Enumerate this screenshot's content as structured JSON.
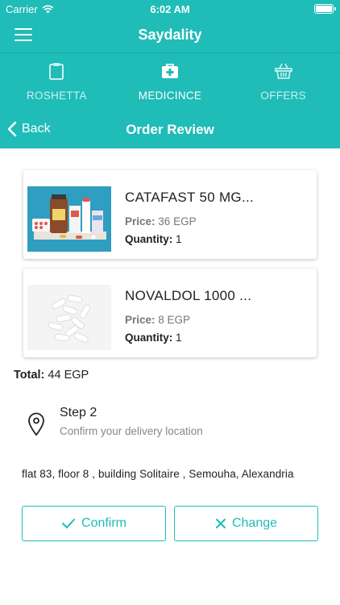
{
  "status_bar": {
    "carrier": "Carrier",
    "time": "6:02 AM"
  },
  "app_bar": {
    "title": "Saydality"
  },
  "tabs": [
    {
      "label": "ROSHETTA",
      "icon": "clipboard-icon",
      "active": false
    },
    {
      "label": "MEDICINCE",
      "icon": "medical-kit-icon",
      "active": true
    },
    {
      "label": "OFFERS",
      "icon": "basket-icon",
      "active": false
    }
  ],
  "sub_bar": {
    "back_label": "Back",
    "title": "Order Review"
  },
  "products": [
    {
      "name": "CATAFAST 50 MG...",
      "price_label": "Price:",
      "price": "36 EGP",
      "quantity_label": "Quantity:",
      "quantity": "1"
    },
    {
      "name": "NOVALDOL 1000 ...",
      "price_label": "Price:",
      "price": "8 EGP",
      "quantity_label": "Quantity:",
      "quantity": "1"
    }
  ],
  "total": {
    "label": "Total:",
    "value": "44 EGP"
  },
  "step": {
    "title": "Step 2",
    "subtitle": "Confirm your delivery location"
  },
  "address": "flat 83, floor 8 , building Solitaire , Semouha, Alexandria",
  "buttons": {
    "confirm_label": "Confirm",
    "change_label": "Change"
  },
  "colors": {
    "accent": "#1fbcb8",
    "tab_inactive": "#c9f1ef"
  }
}
